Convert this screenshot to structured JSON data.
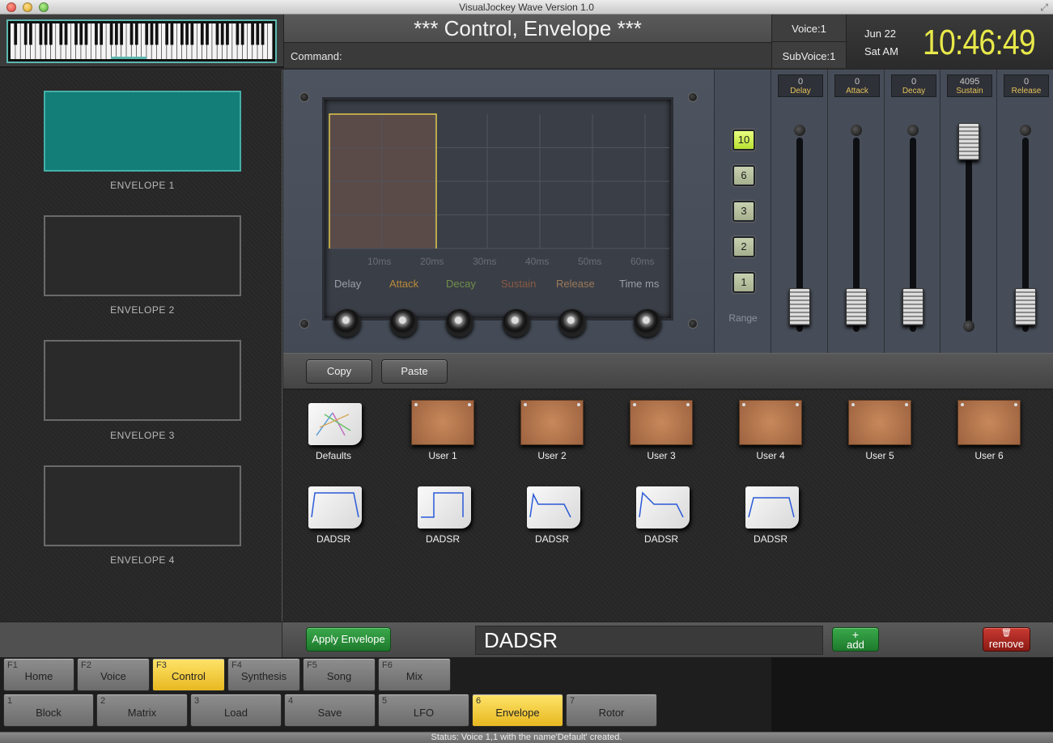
{
  "window": {
    "title": "VisualJockey Wave Version 1.0"
  },
  "header": {
    "title": "*** Control, Envelope ***",
    "command_label": "Command:",
    "voice": "Voice:1",
    "subvoice": "SubVoice:1",
    "date": "Jun 22",
    "day": "Sat AM",
    "time": "10:46:49"
  },
  "sidebar": {
    "envelopes": [
      {
        "label": "ENVELOPE 1",
        "selected": true
      },
      {
        "label": "ENVELOPE 2",
        "selected": false
      },
      {
        "label": "ENVELOPE 3",
        "selected": false
      },
      {
        "label": "ENVELOPE 4",
        "selected": false
      }
    ]
  },
  "graph": {
    "x_ticks": [
      "10ms",
      "20ms",
      "30ms",
      "40ms",
      "50ms",
      "60ms"
    ],
    "axis_names": [
      {
        "label": "Delay",
        "color": "#9a9fa8"
      },
      {
        "label": "Attack",
        "color": "#b88a3a"
      },
      {
        "label": "Decay",
        "color": "#6f8f4a"
      },
      {
        "label": "Sustain",
        "color": "#8a5a44"
      },
      {
        "label": "Release",
        "color": "#9c7a5a"
      },
      {
        "label": "Time ms",
        "color": "#9a9fa8"
      }
    ],
    "envelope_color": "#e0c84a",
    "fill_color": "#5a4a48"
  },
  "range": {
    "buttons": [
      "10",
      "6",
      "3",
      "2",
      "1"
    ],
    "selected": "10",
    "label": "Range"
  },
  "sliders": [
    {
      "name": "Delay",
      "value": "0",
      "level": 0
    },
    {
      "name": "Attack",
      "value": "0",
      "level": 0
    },
    {
      "name": "Decay",
      "value": "0",
      "level": 0
    },
    {
      "name": "Sustain",
      "value": "4095",
      "level": 1
    },
    {
      "name": "Release",
      "value": "0",
      "level": 0
    }
  ],
  "actions": {
    "copy": "Copy",
    "paste": "Paste"
  },
  "presets": {
    "row1": [
      "Defaults",
      "User 1",
      "User 2",
      "User 3",
      "User 4",
      "User 5",
      "User 6"
    ],
    "row2": [
      "DADSR",
      "DADSR",
      "DADSR",
      "DADSR",
      "DADSR"
    ]
  },
  "apply_bar": {
    "apply_label": "Apply Envelope",
    "name_value": "DADSR",
    "add_symbol": "+",
    "add_label": "add",
    "remove_icon": "trash-icon",
    "remove_label": "remove"
  },
  "nav": {
    "row1": [
      {
        "key": "F1",
        "label": "Home",
        "active": false
      },
      {
        "key": "F2",
        "label": "Voice",
        "active": false
      },
      {
        "key": "F3",
        "label": "Control",
        "active": true
      },
      {
        "key": "F4",
        "label": "Synthesis",
        "active": false
      },
      {
        "key": "F5",
        "label": "Song",
        "active": false
      },
      {
        "key": "F6",
        "label": "Mix",
        "active": false
      }
    ],
    "row2": [
      {
        "key": "1",
        "label": "Block",
        "active": false
      },
      {
        "key": "2",
        "label": "Matrix",
        "active": false
      },
      {
        "key": "3",
        "label": "Load",
        "active": false
      },
      {
        "key": "4",
        "label": "Save",
        "active": false
      },
      {
        "key": "5",
        "label": "LFO",
        "active": false
      },
      {
        "key": "6",
        "label": "Envelope",
        "active": true
      },
      {
        "key": "7",
        "label": "Rotor",
        "active": false
      }
    ]
  },
  "status": {
    "text": "Status: Voice 1,1 with the name'Default' created."
  }
}
